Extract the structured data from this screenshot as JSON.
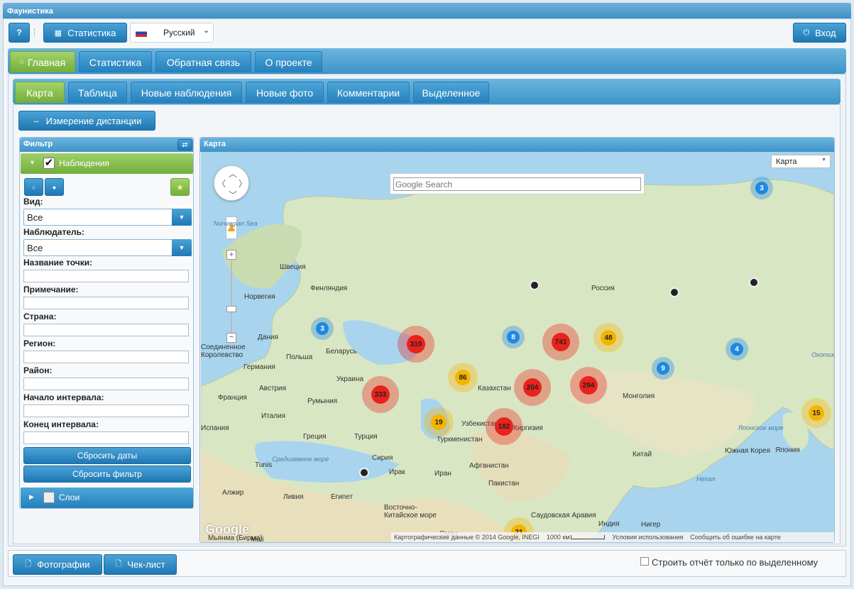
{
  "app": {
    "title": "Фаунистика"
  },
  "toolbar": {
    "help_label": "?",
    "stats_label": "Статистика",
    "language": "Русский",
    "login_label": "Вход"
  },
  "main_tabs": [
    "Главная",
    "Статистика",
    "Обратная связь",
    "О проекте"
  ],
  "sub_tabs": [
    "Карта",
    "Таблица",
    "Новые наблюдения",
    "Новые фото",
    "Комментарии",
    "Выделенное"
  ],
  "measure_button": "Измерение дистанции",
  "filter": {
    "title": "Фильтр",
    "observations_label": "Наблюдения",
    "observations_checked": true,
    "view_label": "Вид:",
    "view_value": "Все",
    "observer_label": "Наблюдатель:",
    "observer_value": "Все",
    "point_name_label": "Название точки:",
    "note_label": "Примечание:",
    "country_label": "Страна:",
    "region_label": "Регион:",
    "district_label": "Район:",
    "start_label": "Начало интервала:",
    "end_label": "Конец интервала:",
    "reset_dates": "Сбросить даты",
    "reset_filter": "Сбросить фильтр",
    "layers_label": "Слои"
  },
  "map": {
    "title": "Карта",
    "search_placeholder": "Google Search",
    "type_select": "Карта",
    "google_logo": "Google",
    "attribution": "Картографические данные © 2014 Google, INEGI",
    "scale": "1000 км",
    "terms": "Условия использования",
    "report": "Сообщить об ошибке на карте",
    "clusters": [
      {
        "label": "3",
        "color": "#1e88e5"
      },
      {
        "label": "3",
        "color": "#1e88e5"
      },
      {
        "label": "310",
        "color": "#e8231c"
      },
      {
        "label": "8",
        "color": "#1e88e5"
      },
      {
        "label": "741",
        "color": "#e8231c"
      },
      {
        "label": "48",
        "color": "#f5b400"
      },
      {
        "label": "4",
        "color": "#1e88e5"
      },
      {
        "label": "86",
        "color": "#f5b400"
      },
      {
        "label": "204",
        "color": "#e8231c"
      },
      {
        "label": "294",
        "color": "#e8231c"
      },
      {
        "label": "9",
        "color": "#1e88e5"
      },
      {
        "label": "333",
        "color": "#e8231c"
      },
      {
        "label": "19",
        "color": "#f5b400"
      },
      {
        "label": "182",
        "color": "#e8231c"
      },
      {
        "label": "15",
        "color": "#f5b400"
      },
      {
        "label": "21",
        "color": "#f5b400"
      }
    ],
    "places": [
      "Norwegian Sea",
      "Швеция",
      "Финляндия",
      "Норвегия",
      "Россия",
      "Дания",
      "Соединенное Королевство",
      "Беларусь",
      "Польша",
      "Германия",
      "Украина",
      "Австрия",
      "Франция",
      "Румыния",
      "Казахстан",
      "Монголия",
      "Италия",
      "Узбекистан",
      "Киргизия",
      "Испания",
      "Турция",
      "Греция",
      "Туркменистан",
      "Китай",
      "Южная Корея",
      "Япония",
      "Японское море",
      "Охотское море",
      "Tunis",
      "Сирия",
      "Средиземное море",
      "Ирак",
      "Иран",
      "Афганистан",
      "Алжир",
      "Ливия",
      "Египет",
      "Пакистан",
      "Непал",
      "Восточно-Китайское море",
      "Саудовская Аравия",
      "Индия",
      "Мьянма (Бирма)",
      "Mali",
      "Нигер",
      "Оман"
    ]
  },
  "bottom": {
    "photos_label": "Фотографии",
    "checklist_label": "Чек-лист",
    "report_only_selected": "Строить отчёт только по выделенному"
  }
}
